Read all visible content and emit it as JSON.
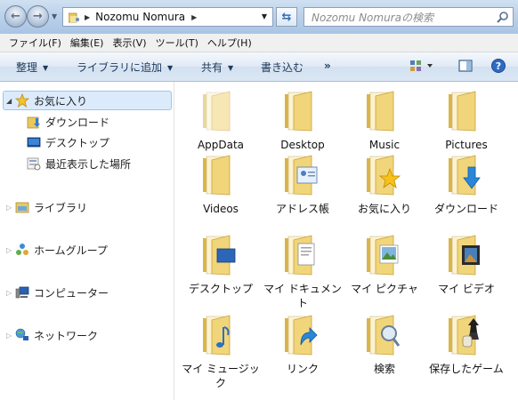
{
  "address": {
    "crumb": "Nozomu Nomura"
  },
  "search": {
    "placeholder": "Nozomu Nomuraの検索"
  },
  "menu": [
    "ファイル(F)",
    "編集(E)",
    "表示(V)",
    "ツール(T)",
    "ヘルプ(H)"
  ],
  "commands": {
    "organize": "整理",
    "add_to_library": "ライブラリに追加",
    "share": "共有",
    "burn": "書き込む",
    "more": "»"
  },
  "nav": {
    "favorites": "お気に入り",
    "downloads": "ダウンロード",
    "desktop": "デスクトップ",
    "recent": "最近表示した場所",
    "libraries": "ライブラリ",
    "homegroup": "ホームグループ",
    "computer": "コンピューター",
    "network": "ネットワーク"
  },
  "folders": [
    "AppData",
    "Desktop",
    "Music",
    "Pictures",
    "Videos",
    "アドレス帳",
    "お気に入り",
    "ダウンロード",
    "デスクトップ",
    "マイ ドキュメント",
    "マイ ピクチャ",
    "マイ ビデオ",
    "マイ ミュージック",
    "リンク",
    "検索",
    "保存したゲーム"
  ],
  "colors": {
    "folder": "#f1d57a",
    "folder_dark": "#d9b54a",
    "selection": "#dcebfc",
    "command_text": "#1e395b"
  }
}
